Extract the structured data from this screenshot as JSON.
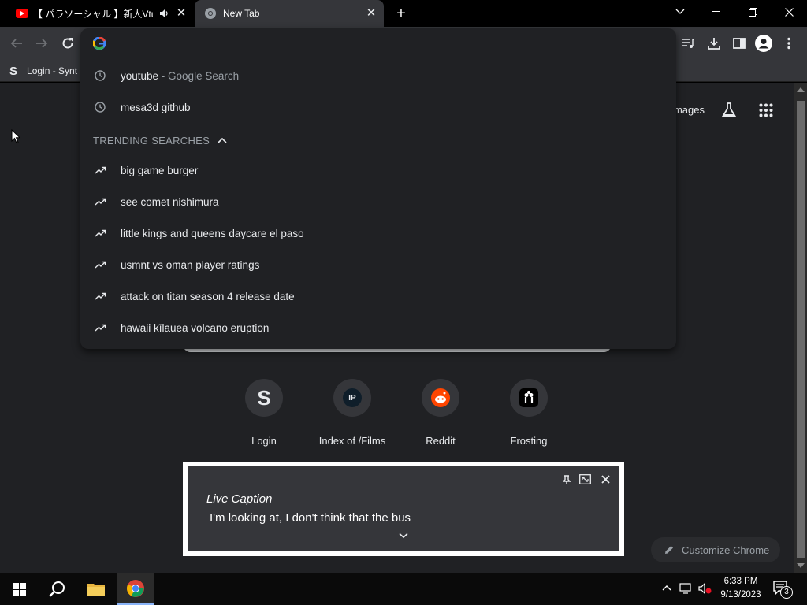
{
  "tabs": [
    {
      "title": "【 パラソーシャル 】新人Vtuberの",
      "icon": "youtube-icon",
      "audio": true
    },
    {
      "title": "New Tab",
      "icon": "chrome-icon",
      "active": true
    }
  ],
  "bookmarks": [
    {
      "label": "Login - Synt",
      "icon": "s-icon"
    }
  ],
  "omnibox": {
    "value": "",
    "history": [
      {
        "text": "youtube",
        "sub": " - Google Search"
      },
      {
        "text": "mesa3d github",
        "sub": ""
      }
    ],
    "trending_header": "TRENDING SEARCHES",
    "trending": [
      "big game burger",
      "see comet nishimura",
      "little kings and queens daycare el paso",
      "usmnt vs oman player ratings",
      "attack on titan season 4 release date",
      "hawaii kīlauea volcano eruption"
    ]
  },
  "header_links": {
    "images": "Images"
  },
  "shortcuts": [
    {
      "label": "Login",
      "glyph": "S"
    },
    {
      "label": "Index of /Films",
      "glyph": "IP"
    },
    {
      "label": "Reddit",
      "glyph": ""
    },
    {
      "label": "Frosting",
      "glyph": ""
    }
  ],
  "live_caption": {
    "title": "Live Caption",
    "text": "I'm looking at, I don't think that the bus"
  },
  "customize_label": "Customize Chrome",
  "taskbar": {
    "time": "6:33 PM",
    "date": "9/13/2023",
    "notification_count": "3"
  },
  "colors": {
    "tabstrip": "#000000",
    "toolbar": "#35363a",
    "page_bg": "#202124",
    "text": "#e8eaed",
    "muted": "#9aa0a6",
    "reddit": "#ff4500"
  }
}
